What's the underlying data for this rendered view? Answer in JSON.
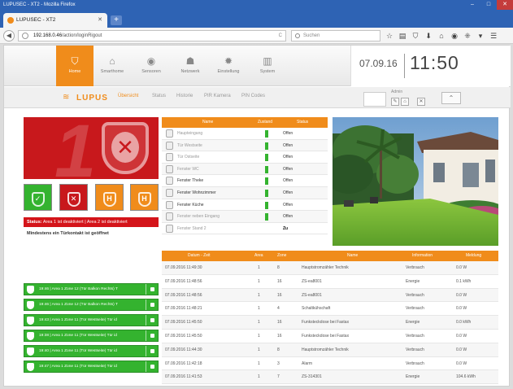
{
  "browser": {
    "window_title": "LUPUSEC - XT2 - Mozilla Firefox",
    "window_buttons": [
      "–",
      "□",
      "✕"
    ],
    "tab_title": "LUPUSEC - XT2",
    "tab_close": "✕",
    "new_tab": "+",
    "back": "◀",
    "url_host": "192.168.0.46",
    "url_path": "/action/loginRigout",
    "reload": "C",
    "search_placeholder": "Suchen",
    "toolbar_icons": [
      "☆",
      "▤",
      "⛉",
      "⬇",
      "⌂",
      "◉",
      "⁜",
      "▾",
      "☰"
    ]
  },
  "topnav": {
    "items": [
      {
        "label": "Home",
        "icon": "shield-icon",
        "glyph": "⛉"
      },
      {
        "label": "Smarthome",
        "icon": "house-icon",
        "glyph": "⌂"
      },
      {
        "label": "Sensoren",
        "icon": "sensor-icon",
        "glyph": "◉"
      },
      {
        "label": "Netzwerk",
        "icon": "network-icon",
        "glyph": "☗"
      },
      {
        "label": "Einstellung",
        "icon": "gear-icon",
        "glyph": "✹"
      },
      {
        "label": "System",
        "icon": "bars-icon",
        "glyph": "▥"
      }
    ],
    "date": "07.09.16",
    "time": "11:50"
  },
  "subnav": {
    "logo_text": "LUPUS",
    "tabs": [
      "Übersicht",
      "Status",
      "Historie",
      "PIR Kamera",
      "PIN Codes"
    ],
    "admin_label": "Admin",
    "admin_buttons": [
      "✎",
      "⌂",
      "✕"
    ],
    "up_button": "⌃"
  },
  "alarm": {
    "area_number": "1",
    "shield_glyph": "✕",
    "mode_buttons": [
      {
        "glyph": "✓",
        "color": "#34b32f",
        "name": "arm-mode-green"
      },
      {
        "glyph": "✕",
        "color": "#c8181c",
        "name": "disarm-mode-red"
      },
      {
        "glyph": "H",
        "color": "#f08c1b",
        "name": "home-mode-1"
      },
      {
        "glyph": "H",
        "color": "#f08c1b",
        "name": "home-mode-2"
      }
    ],
    "status_label": "Status:",
    "status_text": "Area 1 ist deaktiviert | Area 2 ist deaktiviert",
    "message": "Mindestens ein Türkontakt ist geöffnet"
  },
  "green_events": [
    "19:46 | Area 1 Zone 12 (Tür Balkon Rechts) T",
    "19:46 | Area 1 Zone 12 (Tür Balkon Rechts) T",
    "19:43 | Area 1 Zone 11 (Tür Westseite) Tür id",
    "19:38 | Area 1 Zone 11 (Tür Westseite) Tür id",
    "19:40 | Area 1 Zone 11 (Tür Westseite) Tür id",
    "19:47 | Area 1 Zone 11 (Tür Westseite) Tür id"
  ],
  "sensor_table": {
    "headers": [
      "Name",
      "Zustand",
      "Status"
    ],
    "rows": [
      {
        "name": "Haupteingang",
        "state": "Offen",
        "dark": false
      },
      {
        "name": "Tür Westseite",
        "state": "Offen",
        "dark": false
      },
      {
        "name": "Tür Ostseite",
        "state": "Offen",
        "dark": false
      },
      {
        "name": "Fenster WC",
        "state": "Offen",
        "dark": false
      },
      {
        "name": "Fenster Theke",
        "state": "Offen",
        "dark": true
      },
      {
        "name": "Fenster Wohnzimmer",
        "state": "Offen",
        "dark": true
      },
      {
        "name": "Fenster Küche",
        "state": "Offen",
        "dark": true
      },
      {
        "name": "Fenster neben Eingang",
        "state": "Offen",
        "dark": false
      },
      {
        "name": "Fenster Stand 2",
        "state": "Zu",
        "dark": false
      }
    ]
  },
  "event_table": {
    "headers": [
      "Datum - Zeit",
      "Area",
      "Zone",
      "Name",
      "Information",
      "Meldung"
    ],
    "rows": [
      [
        "07.09.2016 11:49:30",
        "1",
        "8",
        "Hauptstromzähler Technik",
        "Verbrauch",
        "0.0 W"
      ],
      [
        "07.09.2016 11:48:56",
        "1",
        "16",
        "ZS-ea8001",
        "Energie",
        "0.1 kWh"
      ],
      [
        "07.09.2016 11:48:56",
        "1",
        "16",
        "ZS-ea8001",
        "Verbrauch",
        "0.0 W"
      ],
      [
        "07.09.2016 11:48:21",
        "1",
        "4",
        "Schaltkühschaft",
        "Verbrauch",
        "0.0 W"
      ],
      [
        "07.09.2016 11:45:50",
        "1",
        "16",
        "Funksteckdose bei Fastax",
        "Energie",
        "0.0 kWh"
      ],
      [
        "07.09.2016 11:45:50",
        "1",
        "16",
        "Funksteckdose bei Fastax",
        "Verbrauch",
        "0.0 W"
      ],
      [
        "07.09.2016 11:44:30",
        "1",
        "8",
        "Hauptstromzähler Technik",
        "Verbrauch",
        "0.0 W"
      ],
      [
        "07.09.2016 11:42:18",
        "1",
        "3",
        "Alarm",
        "Verbrauch",
        "0.0 W"
      ],
      [
        "07.09.2016 11:41:53",
        "1",
        "7",
        "ZS-314301",
        "Energie",
        "104.6 kWh"
      ]
    ]
  }
}
